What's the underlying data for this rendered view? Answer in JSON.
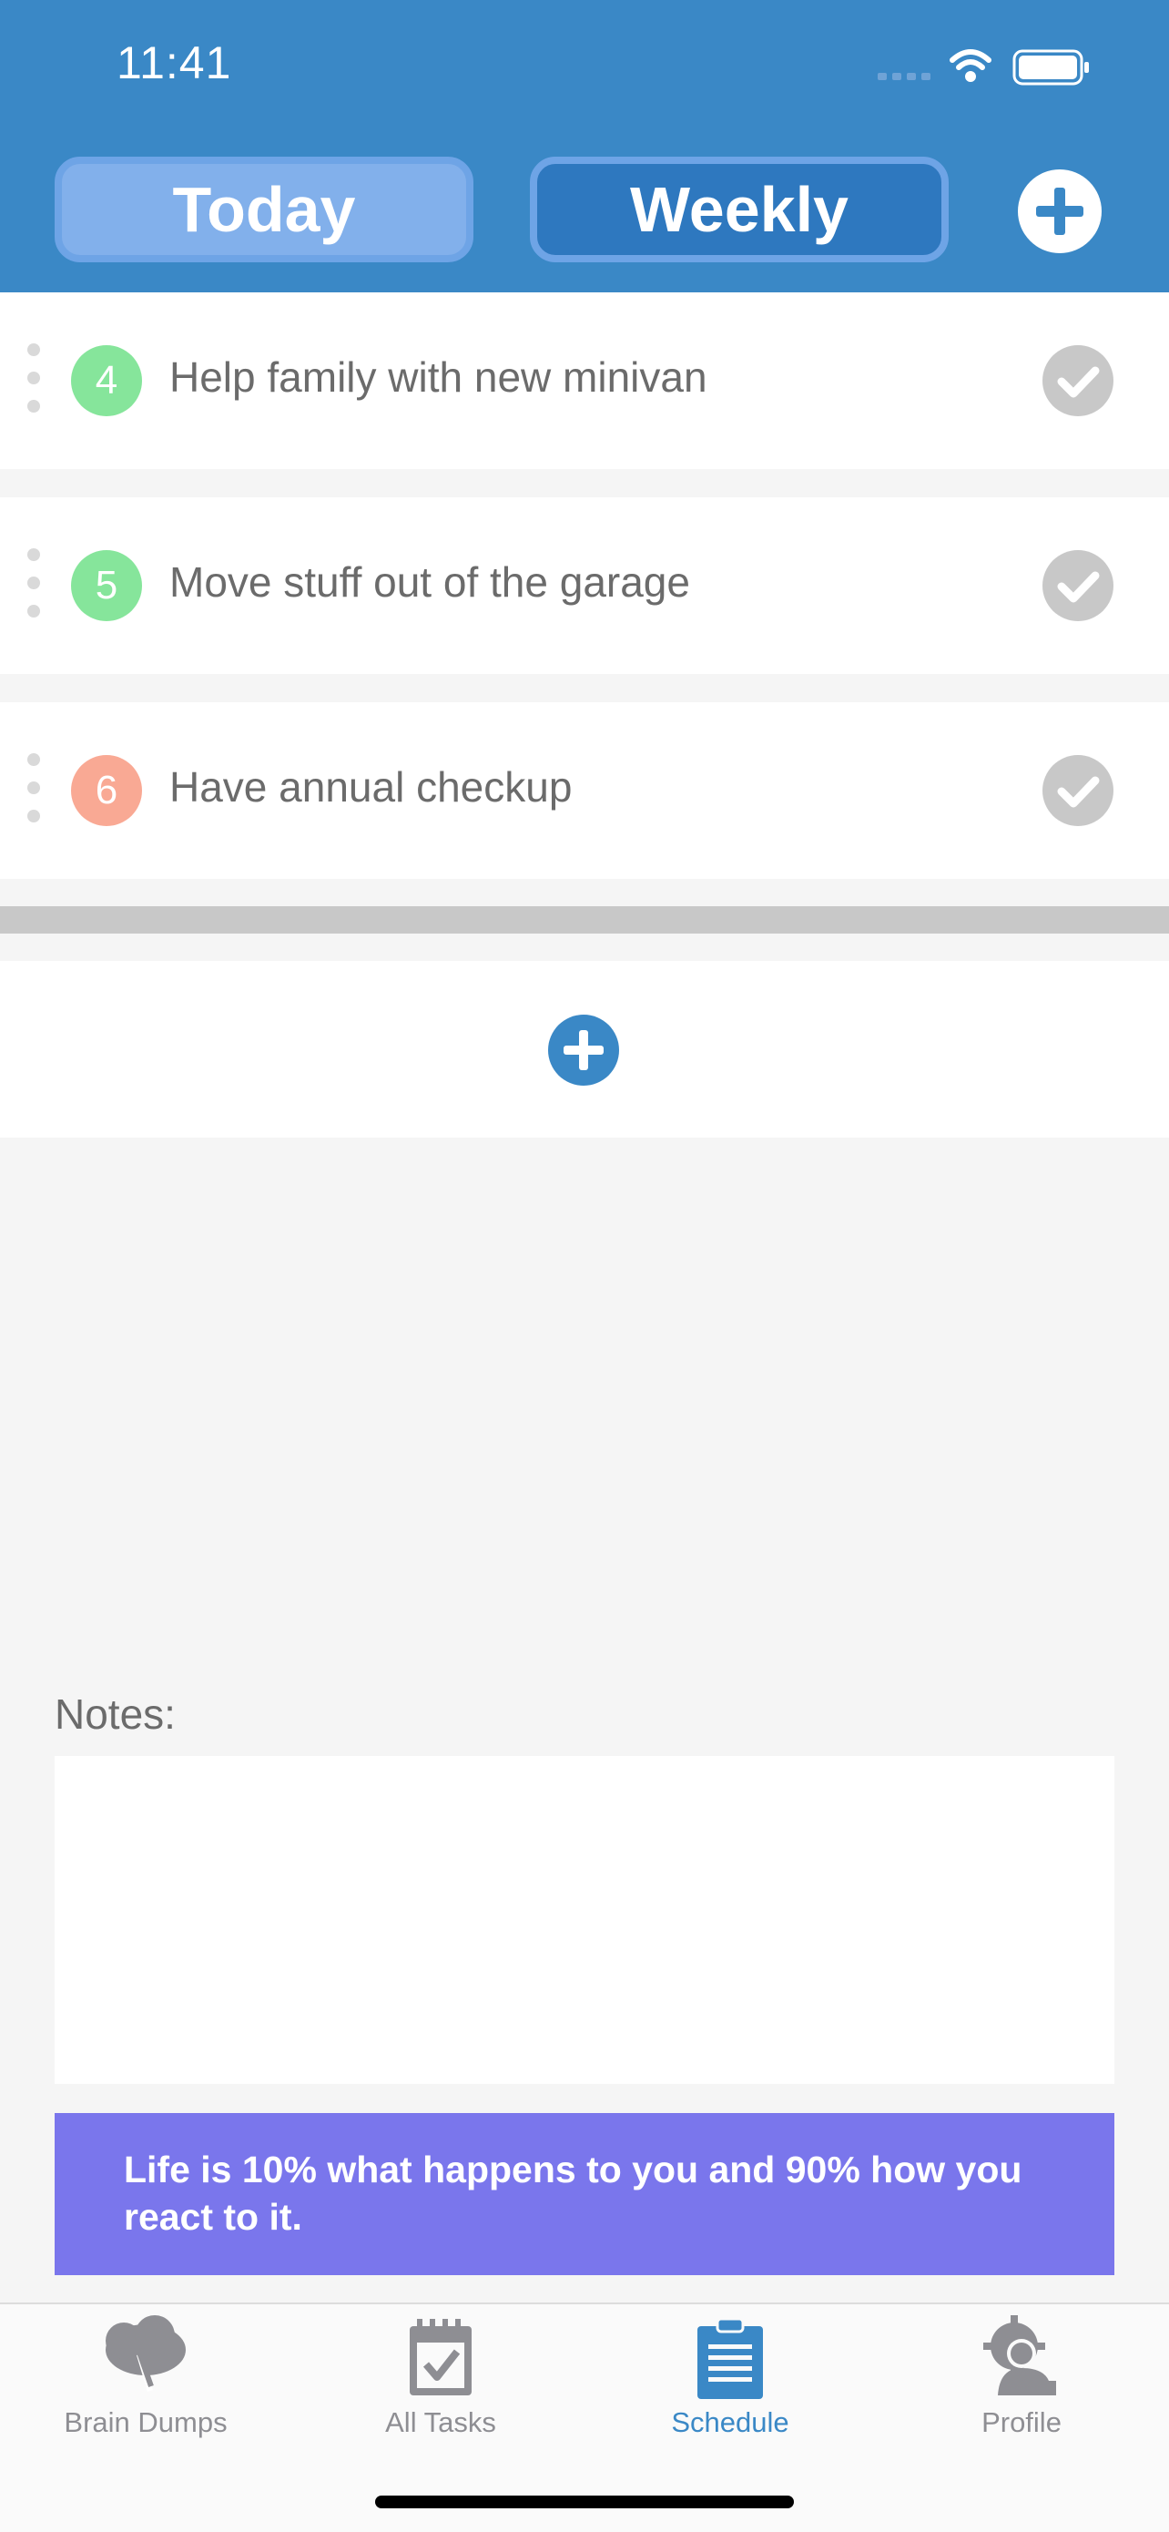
{
  "status_bar": {
    "time": "11:41"
  },
  "header": {
    "tabs": [
      {
        "label": "Today"
      },
      {
        "label": "Weekly"
      }
    ],
    "active_tab": "Today"
  },
  "tasks": [
    {
      "number": "4",
      "text": "Help family with new minivan",
      "badge_color": "#86e59b"
    },
    {
      "number": "5",
      "text": "Move stuff out of the garage",
      "badge_color": "#86e59b"
    },
    {
      "number": "6",
      "text": "Have annual checkup",
      "badge_color": "#f9a994"
    }
  ],
  "notes": {
    "label": "Notes:",
    "value": ""
  },
  "quote": {
    "text": "Life is 10% what happens to you and 90% how you react to it."
  },
  "tabbar": {
    "items": [
      {
        "label": "Brain Dumps",
        "icon": "brain-icon"
      },
      {
        "label": "All Tasks",
        "icon": "calendar-check-icon"
      },
      {
        "label": "Schedule",
        "icon": "clipboard-icon"
      },
      {
        "label": "Profile",
        "icon": "profile-gear-icon"
      }
    ],
    "active": "Schedule"
  },
  "colors": {
    "header_blue": "#3a88c6",
    "accent_blue": "#3a88c6",
    "quote_purple": "#7a76ec",
    "check_gray": "#c8c8c8"
  }
}
